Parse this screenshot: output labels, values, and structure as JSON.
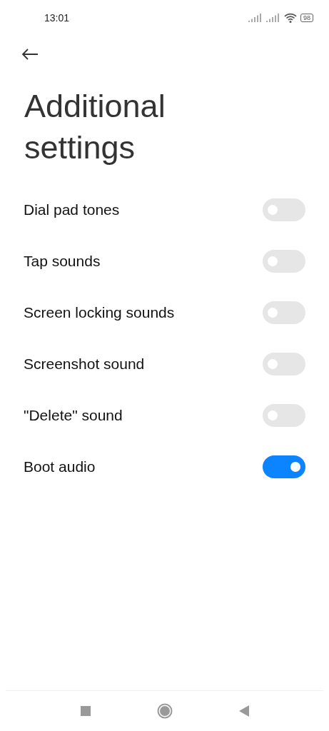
{
  "status_bar": {
    "time": "13:01",
    "battery": "98"
  },
  "title": "Additional settings",
  "settings": [
    {
      "label": "Dial pad tones",
      "on": false
    },
    {
      "label": "Tap sounds",
      "on": false
    },
    {
      "label": "Screen locking sounds",
      "on": false
    },
    {
      "label": "Screenshot sound",
      "on": false
    },
    {
      "label": "\"Delete\" sound",
      "on": false
    },
    {
      "label": "Boot audio",
      "on": true
    }
  ]
}
